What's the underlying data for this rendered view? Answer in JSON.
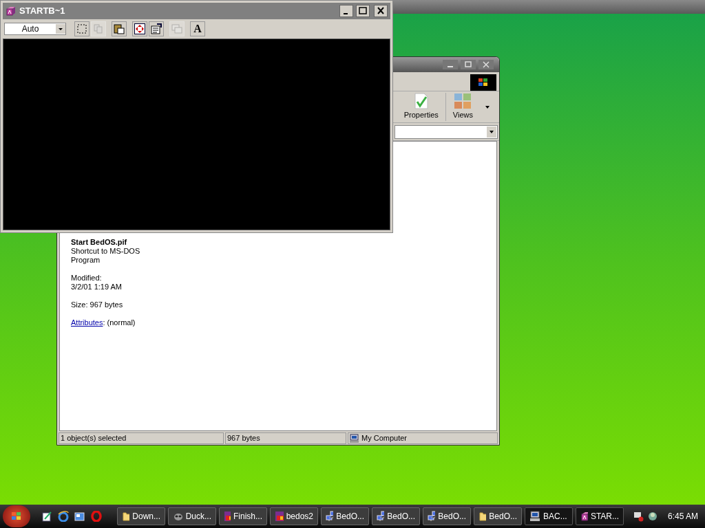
{
  "dos_window": {
    "title": "STARTB~1",
    "font_size": "Auto",
    "tools": [
      {
        "kind": "mark",
        "disabled": false
      },
      {
        "kind": "copy",
        "disabled": true
      },
      {
        "kind": "paste",
        "disabled": false
      },
      {
        "kind": "fullscreen",
        "disabled": false
      },
      {
        "kind": "properties",
        "disabled": false
      },
      {
        "kind": "background",
        "disabled": true
      },
      {
        "kind": "font",
        "label": "A",
        "disabled": false
      }
    ]
  },
  "explorer": {
    "toolbar": [
      {
        "kind": "properties",
        "label": "Properties"
      },
      {
        "kind": "views",
        "label": "Views"
      }
    ],
    "details": {
      "name": "Start BedOS.pif",
      "type": "Shortcut to MS-DOS Program",
      "modified_label": "Modified:",
      "modified": "3/2/01 1:19 AM",
      "size": "Size: 967 bytes",
      "attributes_link": "Attributes",
      "attributes_value": ": (normal)"
    },
    "status_bar": [
      "1 object(s) selected",
      "967 bytes",
      "My Computer"
    ]
  },
  "taskbar": {
    "quick_launch": [
      {
        "kind": "notepad"
      },
      {
        "kind": "browser"
      },
      {
        "kind": "desktop"
      },
      {
        "kind": "opera"
      }
    ],
    "tasks": [
      {
        "label": "Down...",
        "kind": "folder",
        "selected": false
      },
      {
        "label": "Duck...",
        "kind": "raccoon",
        "selected": false
      },
      {
        "label": "Finish...",
        "kind": "vb",
        "selected": false
      },
      {
        "label": "bedos2",
        "kind": "vb",
        "selected": false
      },
      {
        "label": "BedO...",
        "kind": "network",
        "selected": false
      },
      {
        "label": "BedO...",
        "kind": "network",
        "selected": false
      },
      {
        "label": "BedO...",
        "kind": "network",
        "selected": false
      },
      {
        "label": "BedO...",
        "kind": "folder",
        "selected": false
      },
      {
        "label": "BAC...",
        "kind": "computer",
        "selected": true
      },
      {
        "label": "STAR...",
        "kind": "dos",
        "selected": true
      }
    ],
    "clock": "6:45 AM"
  }
}
